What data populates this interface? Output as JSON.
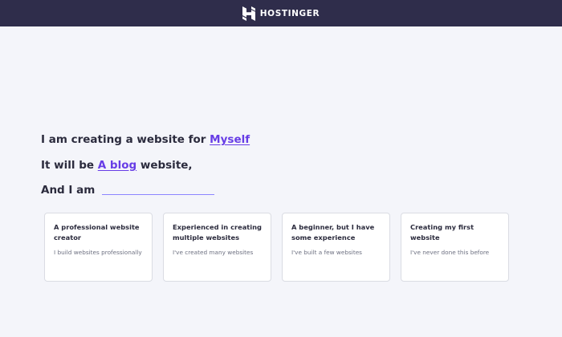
{
  "header": {
    "brand_name": "HOSTINGER",
    "logo_icon": "hostinger-h-logo-icon"
  },
  "form": {
    "line1_prefix": "I am creating a website for",
    "line1_choice": "Myself",
    "line2_prefix": "It will be",
    "line2_choice": "A blog",
    "line2_suffix": "website,",
    "line3_prefix": "And I am",
    "line3_choice": ""
  },
  "options": [
    {
      "title": "A professional website creator",
      "description": "I build websites professionally"
    },
    {
      "title": "Experienced in creating multiple websites",
      "description": "I've created many websites"
    },
    {
      "title": "A beginner, but I have some experience",
      "description": "I've built a few websites"
    },
    {
      "title": "Creating my first website",
      "description": "I've never done this before"
    }
  ],
  "colors": {
    "header_bg": "#2f2d4b",
    "page_bg": "#f4f5fa",
    "accent": "#673de6",
    "text": "#2b2b3d"
  }
}
